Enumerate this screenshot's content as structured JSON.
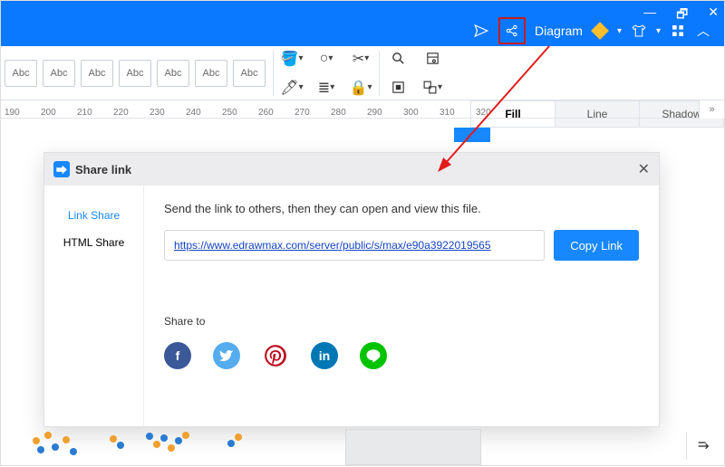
{
  "titlebar": {
    "diagram_label": "Diagram",
    "minimize": "—",
    "restore": "🗗",
    "close": "✕"
  },
  "toolbar": {
    "shape_label": "Abc"
  },
  "ruler_marks": [
    "190",
    "200",
    "210",
    "220",
    "230",
    "240",
    "250",
    "260",
    "270",
    "280",
    "290",
    "300",
    "310",
    "320"
  ],
  "right_panel": {
    "tab_fill": "Fill",
    "tab_line": "Line",
    "tab_shadow": "Shadow"
  },
  "modal": {
    "title": "Share link",
    "side_link": "Link Share",
    "side_html": "HTML Share",
    "instruction": "Send the link to others, then they can open and view this file.",
    "link_value": "https://www.edrawmax.com/server/public/s/max/e90a3922019565",
    "copy_label": "Copy Link",
    "share_to_label": "Share to",
    "social": {
      "facebook": "f",
      "twitter": "t",
      "pinterest": "P",
      "linkedin": "in",
      "line": "L"
    }
  }
}
